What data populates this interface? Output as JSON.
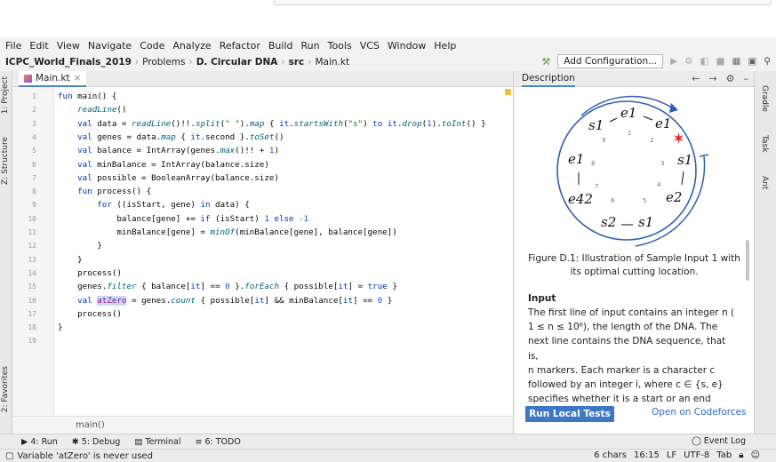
{
  "menu": [
    "File",
    "Edit",
    "View",
    "Navigate",
    "Code",
    "Analyze",
    "Refactor",
    "Build",
    "Run",
    "Tools",
    "VCS",
    "Window",
    "Help"
  ],
  "breadcrumb": {
    "project": "ICPC_World_Finals_2019",
    "items": [
      "Problems",
      "D. Circular DNA",
      "src",
      "Main.kt"
    ]
  },
  "toolbar": {
    "config_label": "Add Configuration..."
  },
  "editor": {
    "tab_label": "Main.kt",
    "lines": [
      {
        "n": "1",
        "tokens": [
          [
            "kw",
            "fun "
          ],
          [
            "plain",
            "main() {"
          ]
        ]
      },
      {
        "n": "2",
        "tokens": [
          [
            "fn",
            "    readLine"
          ],
          [
            "plain",
            "()"
          ]
        ]
      },
      {
        "n": "3",
        "tokens": [
          [
            "kw",
            "    val "
          ],
          [
            "plain",
            "data = "
          ],
          [
            "fn",
            "readLine"
          ],
          [
            "plain",
            "()!!."
          ],
          [
            "fn",
            "split"
          ],
          [
            "plain",
            "("
          ],
          [
            "str",
            "\" \""
          ],
          [
            "plain",
            ")."
          ],
          [
            "fn",
            "map"
          ],
          [
            "plain",
            " { "
          ],
          [
            "kw",
            "it"
          ],
          [
            "plain",
            "."
          ],
          [
            "fn",
            "startsWith"
          ],
          [
            "plain",
            "("
          ],
          [
            "str",
            "\"s\""
          ],
          [
            "plain",
            ") "
          ],
          [
            "kw",
            "to "
          ],
          [
            "kw",
            "it"
          ],
          [
            "plain",
            "."
          ],
          [
            "fn",
            "drop"
          ],
          [
            "plain",
            "("
          ],
          [
            "num",
            "1"
          ],
          [
            "plain",
            ")."
          ],
          [
            "fn",
            "toInt"
          ],
          [
            "plain",
            "() }"
          ]
        ]
      },
      {
        "n": "4",
        "tokens": [
          [
            "kw",
            "    val "
          ],
          [
            "plain",
            "genes = data."
          ],
          [
            "fn",
            "map"
          ],
          [
            "plain",
            " { "
          ],
          [
            "kw",
            "it"
          ],
          [
            "plain",
            ".second }."
          ],
          [
            "fn",
            "toSet"
          ],
          [
            "plain",
            "()"
          ]
        ]
      },
      {
        "n": "5",
        "tokens": [
          [
            "kw",
            "    val "
          ],
          [
            "plain",
            "balance = IntArray(genes."
          ],
          [
            "fn",
            "max"
          ],
          [
            "plain",
            "()!! + "
          ],
          [
            "num",
            "1"
          ],
          [
            "plain",
            ")"
          ]
        ]
      },
      {
        "n": "6",
        "tokens": [
          [
            "kw",
            "    val "
          ],
          [
            "plain",
            "minBalance = IntArray(balance.size)"
          ]
        ]
      },
      {
        "n": "7",
        "tokens": [
          [
            "kw",
            "    val "
          ],
          [
            "plain",
            "possible = BooleanArray(balance.size)"
          ]
        ]
      },
      {
        "n": "8",
        "tokens": [
          [
            "kw",
            "    fun "
          ],
          [
            "plain",
            "process() {"
          ]
        ]
      },
      {
        "n": "9",
        "tokens": [
          [
            "kw",
            "        for "
          ],
          [
            "plain",
            "((isStart, gene) "
          ],
          [
            "kw",
            "in "
          ],
          [
            "plain",
            "data) {"
          ]
        ]
      },
      {
        "n": "10",
        "tokens": [
          [
            "plain",
            "            balance[gene] += "
          ],
          [
            "kw",
            "if "
          ],
          [
            "plain",
            "(isStart) "
          ],
          [
            "num",
            "1 "
          ],
          [
            "kw",
            "else "
          ],
          [
            "num",
            "-1"
          ]
        ]
      },
      {
        "n": "11",
        "tokens": [
          [
            "plain",
            "            minBalance[gene] = "
          ],
          [
            "fn",
            "minOf"
          ],
          [
            "plain",
            "(minBalance[gene], balance[gene])"
          ]
        ]
      },
      {
        "n": "12",
        "tokens": [
          [
            "plain",
            "        }"
          ]
        ]
      },
      {
        "n": "13",
        "tokens": [
          [
            "plain",
            "    }"
          ]
        ]
      },
      {
        "n": "14",
        "tokens": [
          [
            "plain",
            "    process()"
          ]
        ]
      },
      {
        "n": "15",
        "tokens": [
          [
            "plain",
            "    genes."
          ],
          [
            "fn",
            "filter"
          ],
          [
            "plain",
            " { balance["
          ],
          [
            "kw",
            "it"
          ],
          [
            "plain",
            "] == "
          ],
          [
            "num",
            "0"
          ],
          [
            "plain",
            " }."
          ],
          [
            "fn",
            "forEach"
          ],
          [
            "plain",
            " { possible["
          ],
          [
            "kw",
            "it"
          ],
          [
            "plain",
            "] = "
          ],
          [
            "kw",
            "true"
          ],
          [
            "plain",
            " }"
          ]
        ]
      },
      {
        "n": "16",
        "tokens": [
          [
            "kw",
            "    val "
          ],
          [
            "sel",
            "atZero"
          ],
          [
            "plain",
            " = genes."
          ],
          [
            "fn",
            "count"
          ],
          [
            "plain",
            " { possible["
          ],
          [
            "kw",
            "it"
          ],
          [
            "plain",
            "] && minBalance["
          ],
          [
            "kw",
            "it"
          ],
          [
            "plain",
            "] == "
          ],
          [
            "num",
            "0"
          ],
          [
            "plain",
            " }"
          ]
        ]
      },
      {
        "n": "17",
        "tokens": [
          [
            "plain",
            "    process()"
          ]
        ]
      },
      {
        "n": "18",
        "tokens": [
          [
            "plain",
            "}"
          ]
        ]
      },
      {
        "n": "19",
        "tokens": []
      }
    ],
    "footer": "main()"
  },
  "description": {
    "title": "Description",
    "figure_labels": {
      "top": [
        "e1",
        "e1"
      ],
      "left_top": "s1",
      "right_top": "s1",
      "left_mid": "e1",
      "left_bot": "e42",
      "right_bot": "e2",
      "bottom": [
        "s2",
        "s1"
      ]
    },
    "caption_line1": "Figure D.1: Illustration of Sample Input 1 with",
    "caption_line2": "its optimal cutting location.",
    "input_heading": "Input",
    "input_text": [
      "The first line of input contains an integer n (",
      "1 ≤ n ≤ 10⁶), the length of the DNA. The",
      "next line contains the DNA sequence, that is,",
      "n markers. Each marker is a character c",
      "followed by an integer i, where c ∈ {s, e}",
      "specifies whether it is a start or an end"
    ],
    "run_button": "Run Local Tests",
    "cf_link": "Open on Codeforces"
  },
  "toolwindows": [
    "4: Run",
    "5: Debug",
    "Terminal",
    "6: TODO"
  ],
  "event_log": "Event Log",
  "left_tabs": [
    "1: Project",
    "Z: Structure",
    "2: Favorites"
  ],
  "right_tabs": [
    "Gradle",
    "Task",
    "Ant"
  ],
  "status": {
    "message": "Variable 'atZero' is never used",
    "chars": "6 chars",
    "position": "16:15",
    "line_sep": "LF",
    "encoding": "UTF-8",
    "indent": "Tab"
  },
  "colors": {
    "accent": "#3d78c7",
    "arrow": "#2e5fb3",
    "star": "#e02020"
  }
}
